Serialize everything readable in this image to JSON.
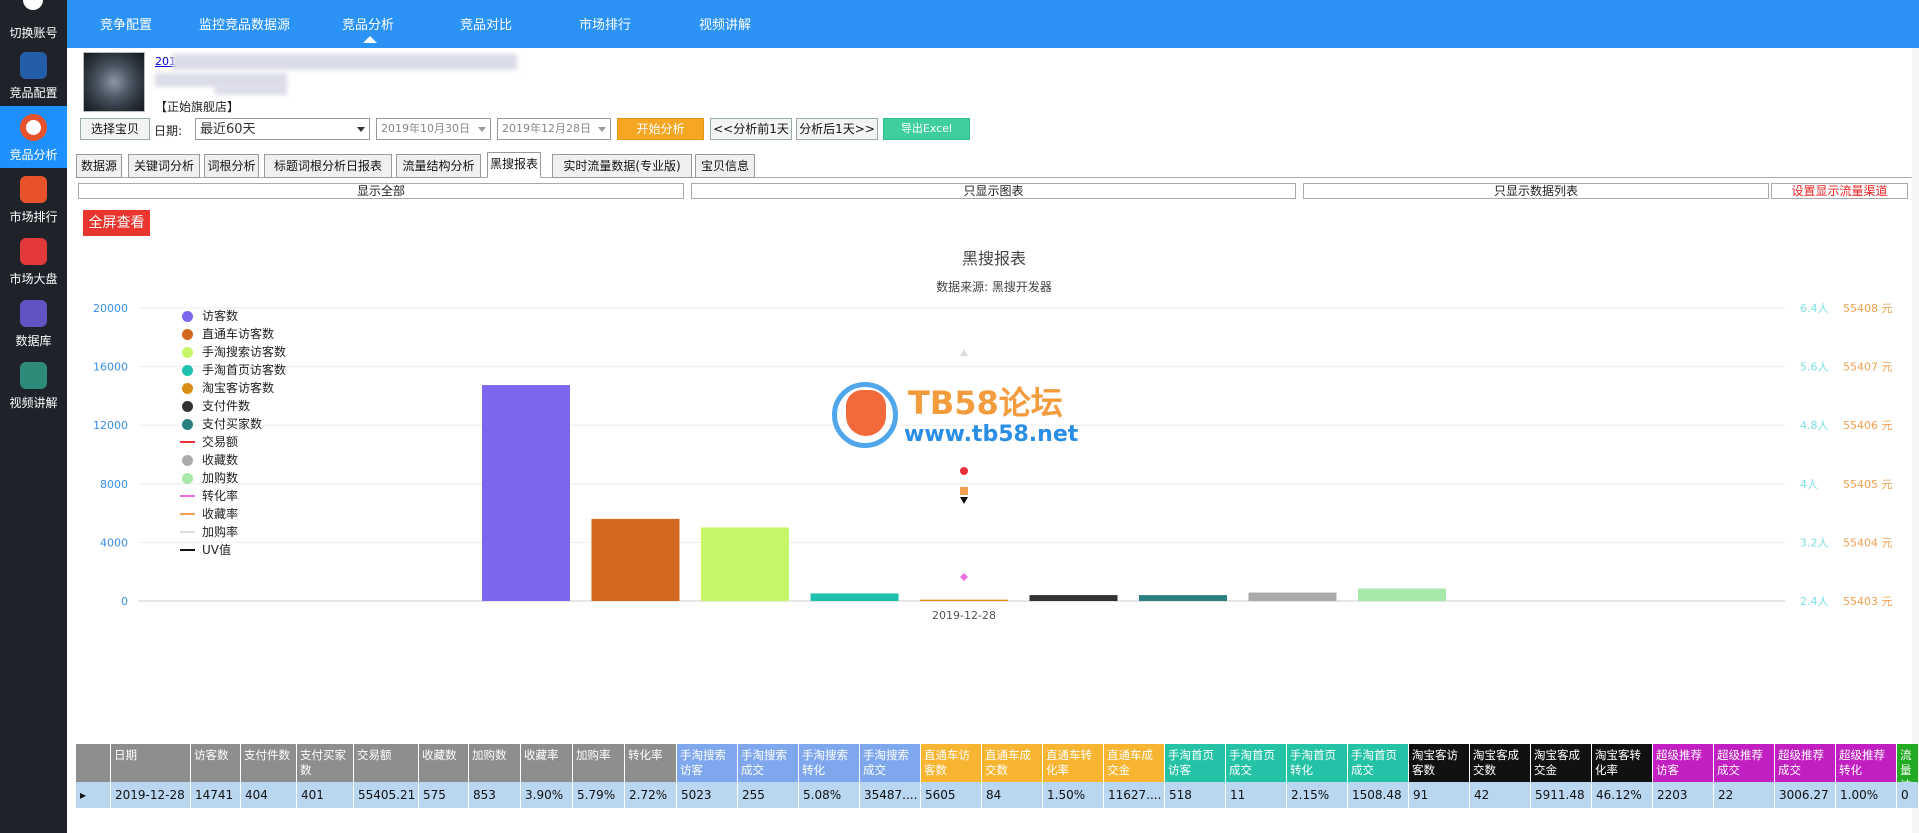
{
  "sidebar": {
    "items": [
      {
        "label": "切换账号",
        "icon": "switch-account-icon",
        "color": "#2a2a2a"
      },
      {
        "label": "竞品配置",
        "icon": "bird-icon",
        "color": "#245ea8"
      },
      {
        "label": "竞品分析",
        "icon": "eye-icon",
        "color": "#e8532b"
      },
      {
        "label": "市场排行",
        "icon": "ranking-icon",
        "color": "#e8532b"
      },
      {
        "label": "市场大盘",
        "icon": "dashboard-icon",
        "color": "#e23a3a"
      },
      {
        "label": "数据库",
        "icon": "database-icon",
        "color": "#6153c4"
      },
      {
        "label": "视频讲解",
        "icon": "video-icon",
        "color": "#2e8b7a"
      }
    ],
    "active": 2
  },
  "topnav": {
    "items": [
      "竞争配置",
      "监控竞品数据源",
      "竞品分析",
      "竞品对比",
      "市场排行",
      "视频讲解"
    ],
    "active": 2
  },
  "product": {
    "title_prefix": "201",
    "shop": "【正始旗舰店】"
  },
  "toolbar": {
    "select_item": "选择宝贝",
    "date_label": "日期:",
    "range": "最近60天",
    "date_start": "2019年10月30日",
    "date_end": "2019年12月28日",
    "start_analysis": "开始分析",
    "prev_day": "<<分析前1天",
    "next_day": "分析后1天>>",
    "export": "导出Excel"
  },
  "tabs": [
    "数据源",
    "关键词分析",
    "词根分析",
    "标题词根分析日报表",
    "流量结构分析",
    "黑搜报表",
    "实时流量数据(专业版)",
    "宝贝信息"
  ],
  "active_tab": 5,
  "view_options": {
    "show_all": "显示全部",
    "chart_only": "只显示图表",
    "list_only": "只显示数据列表",
    "set_channels": "设置显示流量渠道"
  },
  "fullscreen": "全屏查看",
  "watermark": {
    "title": "TB58论坛",
    "url": "www.tb58.net"
  },
  "chart_data": {
    "type": "bar",
    "title": "黑搜报表",
    "subtitle": "数据来源: 黑搜开发器",
    "categories": [
      "2019-12-28"
    ],
    "ylim": [
      0,
      20000
    ],
    "yticks": [
      "0",
      "4000",
      "8000",
      "12000",
      "16000",
      "20000"
    ],
    "y2ticks": [
      "2.4人",
      "3.2人",
      "4人",
      "4.8人",
      "5.6人",
      "6.4人"
    ],
    "y3ticks": [
      "55403 元",
      "55404 元",
      "55405 元",
      "55406 元",
      "55407 元",
      "55408 元"
    ],
    "series": [
      {
        "name": "访客数",
        "type": "bar",
        "color": "#7b68ee",
        "value": 14741
      },
      {
        "name": "直通车访客数",
        "type": "bar",
        "color": "#d2691e",
        "value": 5605
      },
      {
        "name": "手淘搜索访客数",
        "type": "bar",
        "color": "#c6f76a",
        "value": 5023
      },
      {
        "name": "手淘首页访客数",
        "type": "bar",
        "color": "#20c0b0",
        "value": 518
      },
      {
        "name": "淘宝客访客数",
        "type": "bar",
        "color": "#d98e14",
        "value": 91
      },
      {
        "name": "支付件数",
        "type": "bar",
        "color": "#333333",
        "value": 404
      },
      {
        "name": "支付买家数",
        "type": "bar",
        "color": "#2a8080",
        "value": 401
      },
      {
        "name": "交易额",
        "type": "line",
        "color": "#e8303a",
        "value": 55405.21
      },
      {
        "name": "收藏数",
        "type": "bar",
        "color": "#aaaaaa",
        "value": 575
      },
      {
        "name": "加购数",
        "type": "bar",
        "color": "#a8e8a8",
        "value": 853
      },
      {
        "name": "转化率",
        "type": "line",
        "color": "#e870e0",
        "value": 2.72
      },
      {
        "name": "收藏率",
        "type": "line",
        "color": "#f0a050",
        "value": 3.9
      },
      {
        "name": "加购率",
        "type": "line",
        "color": "#dddddd",
        "value": 5.79
      },
      {
        "name": "UV值",
        "type": "line",
        "color": "#111111",
        "value": 3.76
      }
    ],
    "grid": true,
    "legend": "top-left"
  },
  "table": {
    "headers": [
      "日期",
      "访客数",
      "支付件数",
      "支付买家数",
      "交易额",
      "收藏数",
      "加购数",
      "收藏率",
      "加购率",
      "转化率",
      "手淘搜索访客",
      "手淘搜索成交",
      "手淘搜索转化",
      "手淘搜索成交",
      "直通车访客数",
      "直通车成交数",
      "直通车转化率",
      "直通车成交金",
      "手淘首页访客",
      "手淘首页成交",
      "手淘首页转化",
      "手淘首页成交",
      "淘宝客访客数",
      "淘宝客成交数",
      "淘宝客成交金",
      "淘宝客转化率",
      "超级推荐访客",
      "超级推荐成交",
      "超级推荐成交",
      "超级推荐转化",
      "流量访"
    ],
    "row": [
      "2019-12-28",
      "14741",
      "404",
      "401",
      "55405.21",
      "575",
      "853",
      "3.90%",
      "5.79%",
      "2.72%",
      "5023",
      "255",
      "5.08%",
      "35487....",
      "5605",
      "84",
      "1.50%",
      "11627....",
      "518",
      "11",
      "2.15%",
      "1508.48",
      "91",
      "42",
      "5911.48",
      "46.12%",
      "2203",
      "22",
      "3006.27",
      "1.00%",
      "0"
    ]
  }
}
